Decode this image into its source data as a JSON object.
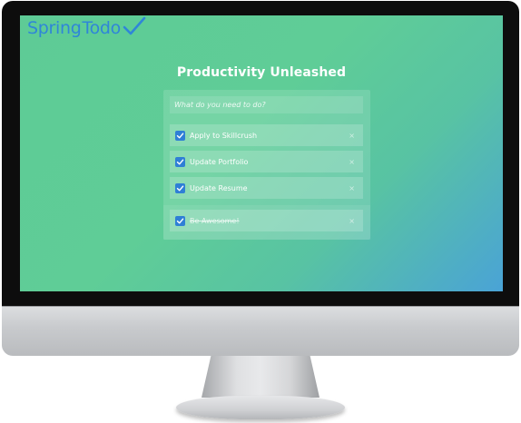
{
  "logo": {
    "part1": "Spring",
    "part2": "Todo",
    "check_icon": "checkmark-icon",
    "color": "#2f86d8"
  },
  "app": {
    "title": "Productivity Unleashed"
  },
  "new_todo": {
    "placeholder": "What do you need to do?",
    "value": ""
  },
  "todos": [
    {
      "label": "Apply to Skillcrush",
      "checked": true,
      "remove_label": "×"
    },
    {
      "label": "Update Portfolio",
      "checked": true,
      "remove_label": "×"
    },
    {
      "label": "Update Resume",
      "checked": true,
      "remove_label": "×"
    }
  ],
  "completed_todos": [
    {
      "label": "Be Awesome!",
      "checked": true,
      "remove_label": "×"
    }
  ],
  "colors": {
    "screen_gradient_start": "#5ecb96",
    "screen_gradient_end": "#4aa3d6",
    "checkbox": "#2f7fd6"
  }
}
